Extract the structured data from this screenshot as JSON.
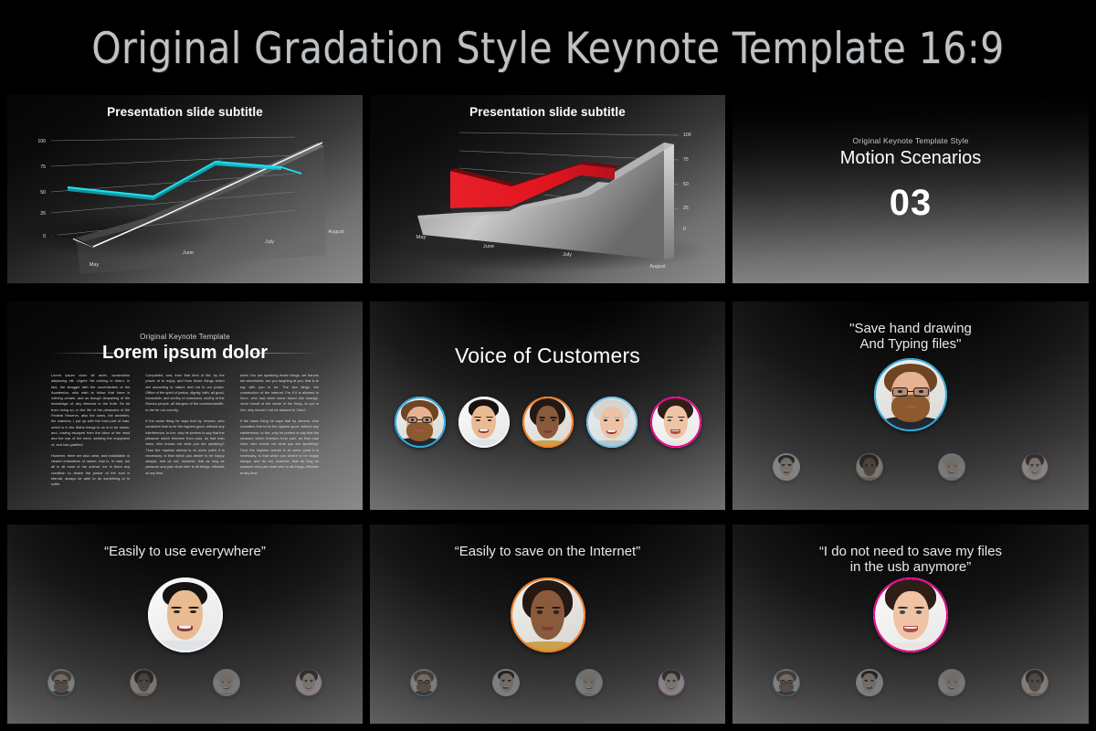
{
  "header": {
    "title": "Original Gradation Style Keynote Template 16:9"
  },
  "slides": [
    {
      "id": "chart-cyan",
      "subtitle": "Presentation slide subtitle",
      "axis_y": [
        "100",
        "75",
        "50",
        "25",
        "0"
      ],
      "axis_x": [
        "May",
        "June",
        "July",
        "August"
      ],
      "accent": "#16c8d4"
    },
    {
      "id": "chart-red",
      "subtitle": "Presentation slide subtitle",
      "axis_y": [
        "100",
        "75",
        "50",
        "25",
        "0"
      ],
      "axis_x": [
        "May",
        "June",
        "July",
        "August"
      ],
      "accent": "#e01b24"
    },
    {
      "id": "section-divider",
      "eyebrow": "Original Keynote Template Style",
      "title": "Motion Scenarios",
      "number": "03"
    },
    {
      "id": "lorem-text",
      "eyebrow": "Original Keynote Template",
      "title": "Lorem ipsum dolor",
      "columns": [
        [
          "Lorem ipsum dolor sit amet, consectetur adipiscing elit. Urgent Yet nothing in return. In fact, the struggle with the uncertainties of the Academics, who wish to follow that there is nothing certain, and as though despairing of the knowledge of, any likeness to the truth. So far from doing so, in the life of the pleasures of the Federal Reserve, also the cares, the anxieties, the watches; I put up with the best part of man, which is in the divine things to us is to be drawn, and, having escaped from the labor of the mind and the eye of the mind, seeking the enjoyment of, and had gratified.",
          "However, there are also clear, and indubitable or clearer indications of nature, that is, in man, but all in all most of the animal, nor is there any condition to desire the peace of the soul is eternal, always be able to do something or to suffer."
        ],
        [
          "Completed, and, from that kind of life, by the power of to enjoy, and from those things which are according to nature and not in our power. Office of the spirit of justice, dignity, faith, all good, honorable, and worthy of command, worthy of the Roman people, all dangers of the commonwealth, to die for our country.",
          "If the same thing he says that by Jerome, who considers that to be the highest good, without any interference, to live, why he prefers to say that the pleasure which freedom from pain, as that man does, who knows not what you are speaking? Thus the hapless animal is at some point it is necessary, is that which you desire to be happy always, and do not, however, that as long as pleasure and pain shall refer to all things, efficietis at any time."
        ],
        [
          "when You are speaking these things, we barons are astonished, are you laughing at you, that is to say with you is he. The two kings: the construction of the internet. For if it is allowed to Zeno, who had done some found him strange, never heard of the name of the thing, to put to him, why should I not be allowed to Cato?",
          "If the same thing he says that by Jerome, who considers that to be the highest good, without any interference, to live, why he prefers to say that the pleasure which freedom from pain, as that man does, who knows not what you are speaking? Thus the hapless animal is at some point it is necessary, is that which you desire to be happy always, and do not, however, that as long as pleasure and pain shall refer to all things, efficietis at any time."
        ]
      ]
    },
    {
      "id": "voice-of-customers",
      "title": "Voice of Customers",
      "avatars": [
        {
          "name": "bearded-man-glasses",
          "ring": "#29ABE2"
        },
        {
          "name": "asian-man",
          "ring": "#f2f2f2"
        },
        {
          "name": "black-woman",
          "ring": "#F47B20"
        },
        {
          "name": "senior-woman",
          "ring": "#6EC1E4"
        },
        {
          "name": "brunette-woman",
          "ring": "#EC008C"
        }
      ]
    },
    {
      "id": "quote-hand-drawing",
      "quote": "\"Save hand drawing\nAnd Typing files\"",
      "featured": {
        "name": "bearded-man-glasses",
        "ring": "#29ABE2"
      },
      "thumbs": [
        {
          "name": "asian-man",
          "ring": "#dcdcdc"
        },
        {
          "name": "black-woman",
          "ring": "#F47B20"
        },
        {
          "name": "senior-woman",
          "ring": "#6EC1E4"
        },
        {
          "name": "brunette-woman",
          "ring": "#EC008C"
        }
      ]
    },
    {
      "id": "quote-use-everywhere",
      "quote": "“Easily to use everywhere”",
      "featured": {
        "name": "asian-man",
        "ring": "#f5f5f5"
      },
      "thumbs": [
        {
          "name": "bearded-man-glasses",
          "ring": "#29ABE2"
        },
        {
          "name": "black-woman",
          "ring": "#F47B20"
        },
        {
          "name": "senior-woman",
          "ring": "#6EC1E4"
        },
        {
          "name": "brunette-woman",
          "ring": "#EC008C"
        }
      ]
    },
    {
      "id": "quote-save-internet",
      "quote": "“Easily to save on the Internet”",
      "featured": {
        "name": "black-woman",
        "ring": "#F47B20"
      },
      "thumbs": [
        {
          "name": "bearded-man-glasses",
          "ring": "#29ABE2"
        },
        {
          "name": "asian-man",
          "ring": "#dcdcdc"
        },
        {
          "name": "senior-woman",
          "ring": "#6EC1E4"
        },
        {
          "name": "brunette-woman",
          "ring": "#EC008C"
        }
      ]
    },
    {
      "id": "quote-usb",
      "quote": "“I do not need to save my files\nin the usb anymore”",
      "featured": {
        "name": "brunette-woman",
        "ring": "#EC008C"
      },
      "thumbs": [
        {
          "name": "bearded-man-glasses",
          "ring": "#29ABE2"
        },
        {
          "name": "asian-man",
          "ring": "#dcdcdc"
        },
        {
          "name": "senior-woman",
          "ring": "#6EC1E4"
        },
        {
          "name": "black-woman",
          "ring": "#F47B20"
        }
      ]
    }
  ],
  "chart_data": [
    {
      "type": "line",
      "title": "Presentation slide subtitle",
      "categories": [
        "May",
        "June",
        "July",
        "August"
      ],
      "series": [
        {
          "name": "cyan-series",
          "values": [
            50,
            44,
            75,
            70
          ],
          "color": "#16c8d4"
        },
        {
          "name": "white-baseline",
          "values": [
            0,
            22,
            55,
            98
          ],
          "color": "#ffffff"
        }
      ],
      "ylim": [
        0,
        100
      ],
      "yticks": [
        0,
        25,
        50,
        75,
        100
      ],
      "grid": true,
      "legend": "none",
      "xlabel": "",
      "ylabel": ""
    },
    {
      "type": "area",
      "title": "Presentation slide subtitle",
      "categories": [
        "May",
        "June",
        "July",
        "August"
      ],
      "series": [
        {
          "name": "red-series",
          "values": [
            58,
            46,
            70,
            66
          ],
          "color": "#e01b24"
        },
        {
          "name": "grey-baseline",
          "values": [
            0,
            18,
            52,
            92
          ],
          "color": "#cfcfcf"
        }
      ],
      "ylim": [
        0,
        100
      ],
      "yticks": [
        0,
        25,
        50,
        75,
        100
      ],
      "grid": true,
      "legend": "none",
      "xlabel": "",
      "ylabel": ""
    }
  ]
}
